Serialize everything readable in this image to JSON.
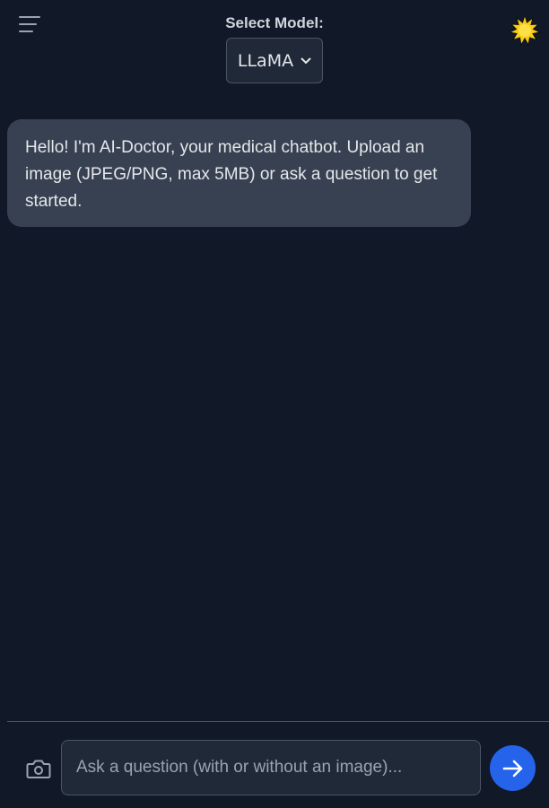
{
  "header": {
    "menu_icon": "hamburger-menu-icon",
    "model_label": "Select Model:",
    "model_selected": "LLaMA",
    "theme_icon": "sun-icon"
  },
  "chat": {
    "messages": [
      {
        "role": "bot",
        "text": "Hello! I'm AI-Doctor, your medical chatbot. Upload an image (JPEG/PNG, max 5MB) or ask a question to get started."
      }
    ]
  },
  "composer": {
    "camera_icon": "camera-icon",
    "placeholder": "Ask a question (with or without an image)...",
    "value": "",
    "send_icon": "arrow-right-icon"
  },
  "colors": {
    "background": "#111827",
    "bubble": "#374151",
    "input_bg": "#1f2937",
    "border": "#4b5563",
    "accent": "#2563eb",
    "sun": "#facc15"
  }
}
